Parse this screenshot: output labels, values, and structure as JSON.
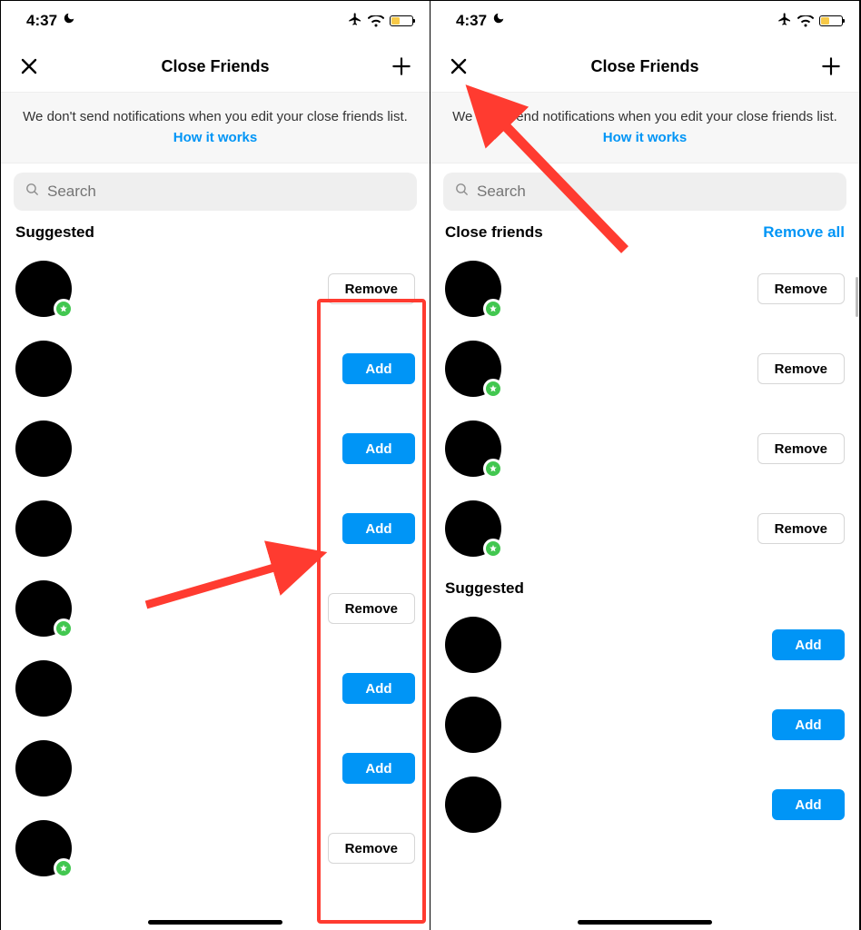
{
  "status": {
    "time": "4:37"
  },
  "nav": {
    "title": "Close Friends"
  },
  "banner": {
    "text": "We don't send notifications when you edit your close friends list. ",
    "link": "How it works"
  },
  "search": {
    "placeholder": "Search"
  },
  "left": {
    "section1": {
      "title": "Suggested"
    },
    "rows": [
      {
        "btn": "Remove",
        "style": "remove",
        "badge": true
      },
      {
        "btn": "Add",
        "style": "add",
        "badge": false
      },
      {
        "btn": "Add",
        "style": "add",
        "badge": false
      },
      {
        "btn": "Add",
        "style": "add",
        "badge": false
      },
      {
        "btn": "Remove",
        "style": "remove",
        "badge": true
      },
      {
        "btn": "Add",
        "style": "add",
        "badge": false
      },
      {
        "btn": "Add",
        "style": "add",
        "badge": false
      },
      {
        "btn": "Remove",
        "style": "remove",
        "badge": true
      }
    ]
  },
  "right": {
    "section1": {
      "title": "Close friends",
      "action": "Remove all"
    },
    "close_rows": [
      {
        "btn": "Remove",
        "style": "remove",
        "badge": true
      },
      {
        "btn": "Remove",
        "style": "remove",
        "badge": true
      },
      {
        "btn": "Remove",
        "style": "remove",
        "badge": true
      },
      {
        "btn": "Remove",
        "style": "remove",
        "badge": true
      }
    ],
    "section2": {
      "title": "Suggested"
    },
    "sugg_rows": [
      {
        "btn": "Add",
        "style": "add",
        "badge": false
      },
      {
        "btn": "Add",
        "style": "add",
        "badge": false
      },
      {
        "btn": "Add",
        "style": "add",
        "badge": false
      }
    ]
  }
}
